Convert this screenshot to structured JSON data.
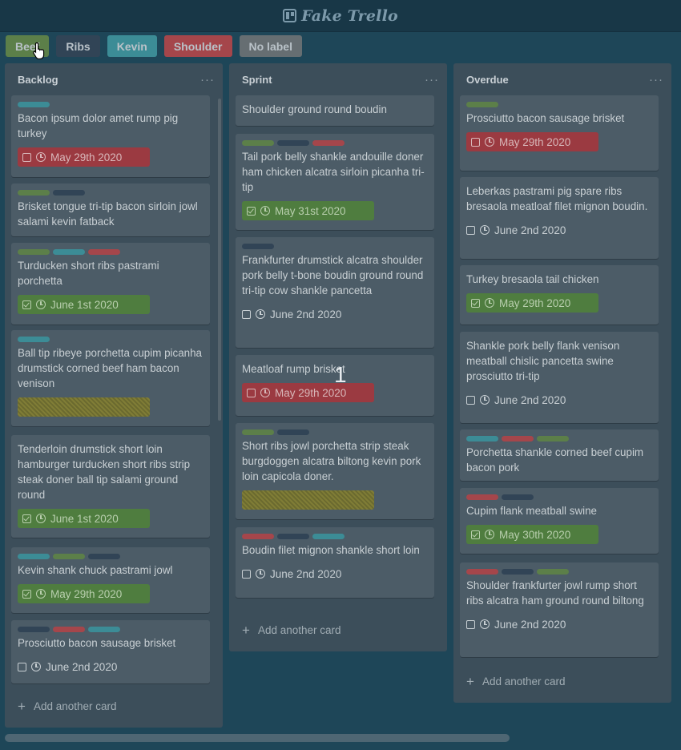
{
  "app": {
    "title": "Fake Trello"
  },
  "colors": {
    "green": "#5c7f49",
    "navy": "#314456",
    "teal": "#3c8c96",
    "red": "#a5464b",
    "gray": "#666e72"
  },
  "filters": [
    {
      "label": "Beef",
      "color": "#5c7f49"
    },
    {
      "label": "Ribs",
      "color": "#314456"
    },
    {
      "label": "Kevin",
      "color": "#3c8c96"
    },
    {
      "label": "Shoulder",
      "color": "#a5464b"
    },
    {
      "label": "No label",
      "color": "#666e72"
    }
  ],
  "overlay": "1",
  "lists": [
    {
      "title": "Backlog",
      "menu": "···",
      "add_label": "Add another card",
      "cards": [
        {
          "labels": [
            "teal"
          ],
          "title": "Bacon ipsum dolor amet rump pig turkey",
          "badge": {
            "style": "red",
            "done": false,
            "date": "May 29th 2020"
          }
        },
        {
          "labels": [
            "green",
            "navy"
          ],
          "title": "Brisket tongue tri-tip bacon sirloin jowl salami kevin fatback"
        },
        {
          "labels": [
            "green",
            "teal",
            "red"
          ],
          "title": "Turducken short ribs pastrami porchetta",
          "badge": {
            "style": "green",
            "done": true,
            "date": "June 1st 2020"
          }
        },
        {
          "labels": [
            "teal"
          ],
          "title": "Ball tip ribeye porchetta cupim picanha drumstick corned beef ham bacon venison",
          "badge": {
            "style": "yellow",
            "done": false,
            "date": ""
          }
        },
        {
          "labels": [],
          "title": "Tenderloin drumstick short loin hamburger turducken short ribs strip steak doner ball tip salami ground round",
          "badge": {
            "style": "green",
            "done": true,
            "date": "June 1st 2020"
          }
        },
        {
          "labels": [
            "teal",
            "green",
            "navy"
          ],
          "title": "Kevin shank chuck pastrami jowl",
          "badge": {
            "style": "green",
            "done": true,
            "date": "May 29th 2020"
          }
        },
        {
          "labels": [
            "navy",
            "red",
            "teal"
          ],
          "title": "Prosciutto bacon sausage brisket",
          "badge": {
            "style": "plain",
            "done": false,
            "date": "June 2nd 2020"
          }
        }
      ]
    },
    {
      "title": "Sprint",
      "menu": "···",
      "add_label": "Add another card",
      "cards": [
        {
          "labels": [],
          "title": "Shoulder ground round boudin"
        },
        {
          "labels": [
            "green",
            "navy",
            "red"
          ],
          "title": "Tail pork belly shankle andouille doner ham chicken alcatra sirloin picanha tri-tip",
          "badge": {
            "style": "green",
            "done": true,
            "date": "May 31st 2020"
          }
        },
        {
          "labels": [
            "navy"
          ],
          "title": "Frankfurter drumstick alcatra shoulder pork belly t-bone boudin ground round tri-tip cow shankle pancetta",
          "badge": {
            "style": "plain",
            "done": false,
            "date": "June 2nd 2020"
          }
        },
        {
          "labels": [],
          "title": "Meatloaf rump brisket",
          "badge": {
            "style": "red",
            "done": false,
            "date": "May 29th 2020"
          }
        },
        {
          "labels": [
            "green",
            "navy"
          ],
          "title": "Short ribs jowl porchetta strip steak burgdoggen alcatra biltong kevin pork loin capicola doner.",
          "badge": {
            "style": "yellow",
            "done": false,
            "date": ""
          }
        },
        {
          "labels": [
            "red",
            "navy",
            "teal"
          ],
          "title": "Boudin filet mignon shankle short loin",
          "badge": {
            "style": "plain",
            "done": false,
            "date": "June 2nd 2020"
          }
        }
      ]
    },
    {
      "title": "Overdue",
      "menu": "···",
      "add_label": "Add another card",
      "cards": [
        {
          "labels": [
            "green"
          ],
          "title": "Prosciutto bacon sausage brisket",
          "badge": {
            "style": "red",
            "done": false,
            "date": "May 29th 2020"
          }
        },
        {
          "labels": [],
          "title": "Leberkas pastrami pig spare ribs bresaola meatloaf filet mignon boudin.",
          "badge": {
            "style": "plain",
            "done": false,
            "date": "June 2nd 2020"
          }
        },
        {
          "labels": [],
          "title": "Turkey bresaola tail chicken",
          "badge": {
            "style": "green",
            "done": true,
            "date": "May 29th 2020"
          }
        },
        {
          "labels": [],
          "title": "Shankle pork belly flank venison meatball chislic pancetta swine prosciutto tri-tip",
          "badge": {
            "style": "plain",
            "done": false,
            "date": "June 2nd 2020"
          }
        },
        {
          "labels": [
            "teal",
            "red",
            "green"
          ],
          "title": "Porchetta shankle corned beef cupim bacon pork"
        },
        {
          "labels": [
            "red",
            "navy"
          ],
          "title": "Cupim flank meatball swine",
          "badge": {
            "style": "green",
            "done": true,
            "date": "May 30th 2020"
          }
        },
        {
          "labels": [
            "red",
            "navy",
            "green"
          ],
          "title": "Shoulder frankfurter jowl rump short ribs alcatra ham ground round biltong",
          "badge": {
            "style": "plain",
            "done": false,
            "date": "June 2nd 2020"
          }
        }
      ]
    }
  ]
}
